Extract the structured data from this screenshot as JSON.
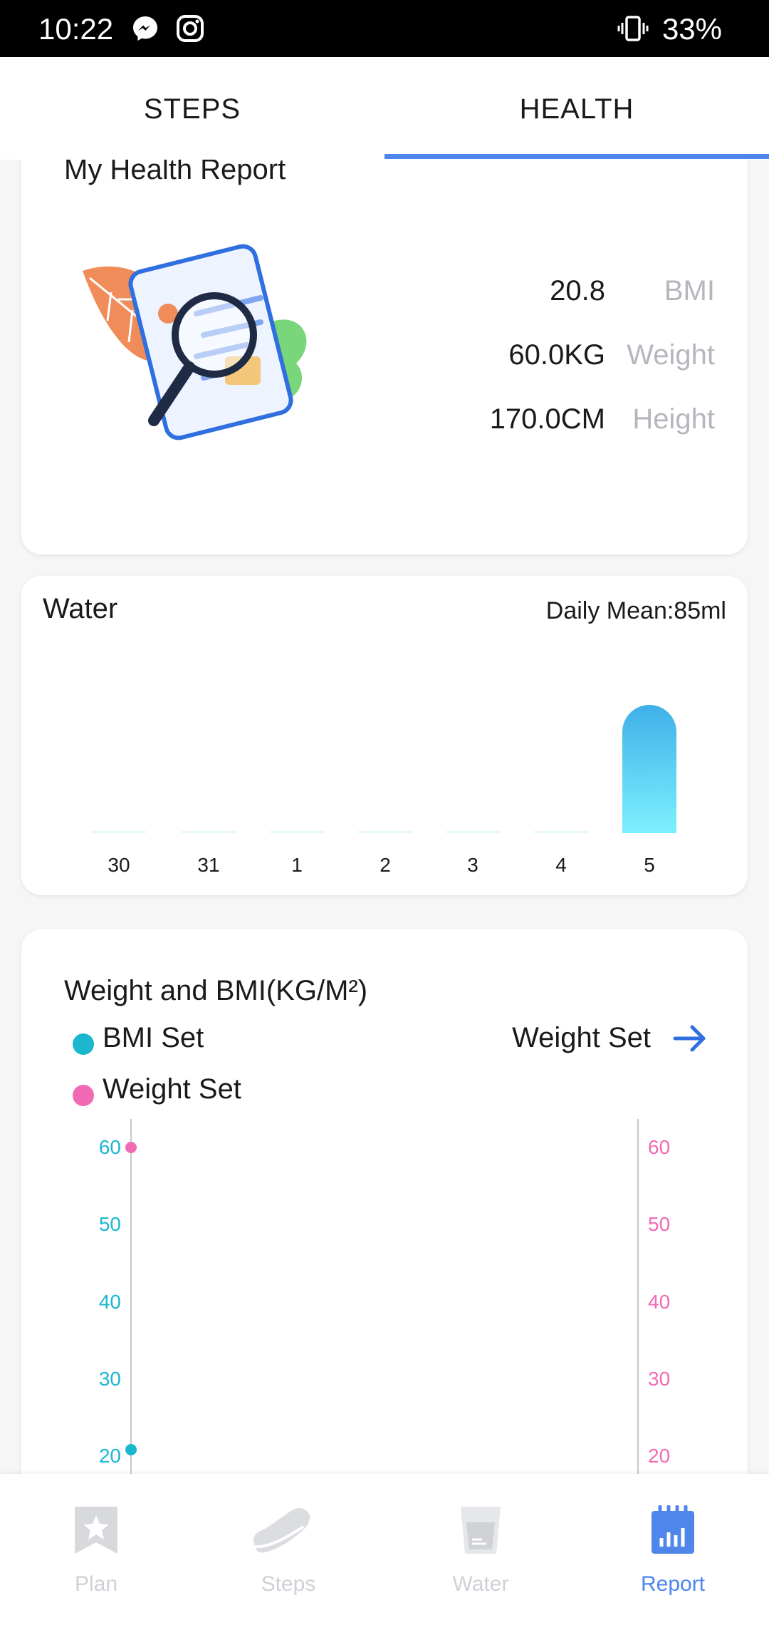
{
  "status_bar": {
    "time": "10:22",
    "battery": "33%"
  },
  "tabs": [
    {
      "label": "STEPS",
      "active": false
    },
    {
      "label": "HEALTH",
      "active": true
    }
  ],
  "health_report": {
    "title": "My Health Report",
    "metrics": [
      {
        "value": "20.8",
        "label": "BMI"
      },
      {
        "value": "60.0KG",
        "label": "Weight"
      },
      {
        "value": "170.0CM",
        "label": "Height"
      }
    ]
  },
  "water": {
    "title": "Water",
    "daily_mean": "Daily Mean:85ml",
    "chart_data": {
      "type": "bar",
      "categories": [
        "30",
        "31",
        "1",
        "2",
        "3",
        "4",
        "5"
      ],
      "values": [
        0,
        0,
        0,
        0,
        0,
        0,
        595
      ]
    }
  },
  "weight_bmi": {
    "title": "Weight and BMI(KG/M²)",
    "legend": [
      {
        "label": "BMI Set",
        "color": "#1ab7cf"
      },
      {
        "label": "Weight Set",
        "color": "#f06ab4"
      }
    ],
    "link_label": "Weight Set",
    "left_ticks": [
      "60",
      "50",
      "40",
      "30",
      "20"
    ],
    "right_ticks": [
      "60",
      "50",
      "40",
      "30",
      "20"
    ],
    "chart_data": {
      "type": "scatter",
      "series": [
        {
          "name": "BMI Set",
          "values": [
            20.8
          ]
        },
        {
          "name": "Weight Set",
          "values": [
            60.0
          ]
        }
      ],
      "ylim": [
        20,
        60
      ]
    }
  },
  "bottom_nav": [
    {
      "label": "Plan",
      "active": false
    },
    {
      "label": "Steps",
      "active": false
    },
    {
      "label": "Water",
      "active": false
    },
    {
      "label": "Report",
      "active": true
    }
  ],
  "colors": {
    "accent": "#4f86ec",
    "bmi": "#1ab7cf",
    "weight": "#f06ab4"
  }
}
